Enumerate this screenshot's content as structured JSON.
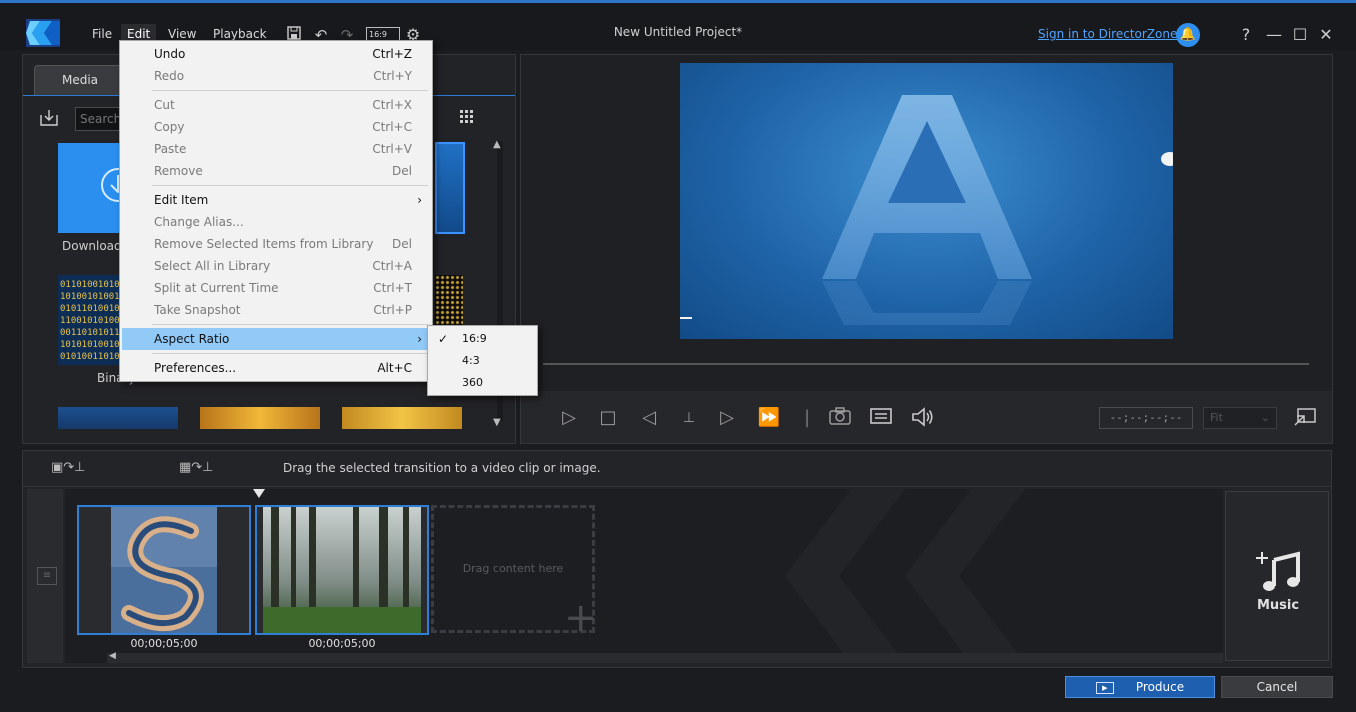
{
  "titlebar": {
    "menus": [
      "File",
      "Edit",
      "View",
      "Playback"
    ],
    "ratio_label": "16:9",
    "project_title": "New Untitled Project*",
    "sign_in": "Sign in to DirectorZone",
    "help": "?"
  },
  "library": {
    "tab": "Media",
    "search_placeholder": "Search t",
    "items": [
      {
        "label": "Download"
      },
      {
        "label": "Binary"
      }
    ]
  },
  "edit_menu": {
    "items": [
      {
        "label": "Undo",
        "shortcut": "Ctrl+Z"
      },
      {
        "label": "Redo",
        "shortcut": "Ctrl+Y"
      },
      {
        "label": "Cut",
        "shortcut": "Ctrl+X"
      },
      {
        "label": "Copy",
        "shortcut": "Ctrl+C"
      },
      {
        "label": "Paste",
        "shortcut": "Ctrl+V"
      },
      {
        "label": "Remove",
        "shortcut": "Del"
      },
      {
        "label": "Edit Item",
        "shortcut": ""
      },
      {
        "label": "Change Alias...",
        "shortcut": ""
      },
      {
        "label": "Remove Selected Items from Library",
        "shortcut": "Del"
      },
      {
        "label": "Select All in Library",
        "shortcut": "Ctrl+A"
      },
      {
        "label": "Split at Current Time",
        "shortcut": "Ctrl+T"
      },
      {
        "label": "Take Snapshot",
        "shortcut": "Ctrl+P"
      },
      {
        "label": "Aspect Ratio",
        "shortcut": ""
      },
      {
        "label": "Preferences...",
        "shortcut": "Alt+C"
      }
    ],
    "submenu_arrow": "›"
  },
  "aspect_submenu": {
    "options": [
      "16:9",
      "4:3",
      "360"
    ],
    "check": "✓"
  },
  "preview": {
    "timecode": "--;--;--;--",
    "fit": "Fit"
  },
  "transition_bar": {
    "hint": "Drag the selected transition to a video clip or image."
  },
  "timeline": {
    "clips": [
      {
        "duration": "00;00;05;00"
      },
      {
        "duration": "00;00;05;00"
      }
    ],
    "drop_hint": "Drag content here",
    "music_label": "Music"
  },
  "footer": {
    "produce": "Produce",
    "cancel": "Cancel"
  }
}
